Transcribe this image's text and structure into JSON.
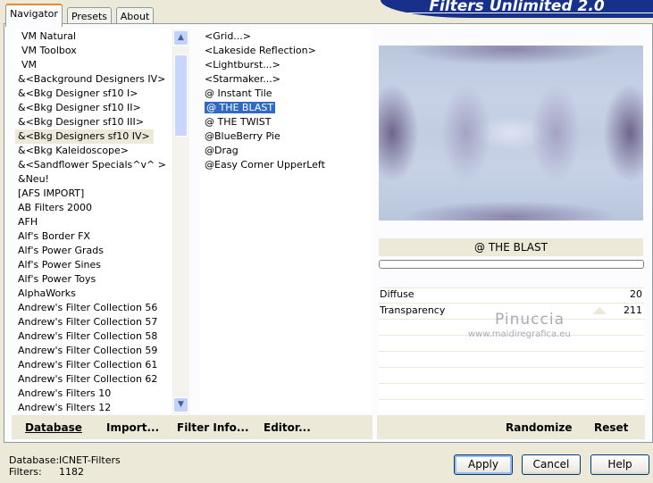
{
  "tabs": [
    {
      "label": "Navigator",
      "active": true
    },
    {
      "label": "Presets",
      "active": false
    },
    {
      "label": "About",
      "active": false
    }
  ],
  "banner": {
    "title": "Filters Unlimited 2.0"
  },
  "categories": [
    "VM Natural",
    "VM Toolbox",
    "VM",
    "&<Background Designers IV>",
    "&<Bkg Designer sf10 I>",
    "&<Bkg Designer sf10 II>",
    "&<Bkg Designer sf10 III>",
    "&<Bkg Designers sf10 IV>",
    "&<Bkg Kaleidoscope>",
    "&<Sandflower Specials^v^ >",
    "&Neu!",
    "[AFS IMPORT]",
    "AB Filters 2000",
    "AFH",
    "Alf's Border FX",
    "Alf's Power Grads",
    "Alf's Power Sines",
    "Alf's Power Toys",
    "AlphaWorks",
    "Andrew's Filter Collection 56",
    "Andrew's Filter Collection 57",
    "Andrew's Filter Collection 58",
    "Andrew's Filter Collection 59",
    "Andrew's Filter Collection 61",
    "Andrew's Filter Collection 62",
    "Andrew's Filters 10",
    "Andrew's Filters 12"
  ],
  "filters": [
    "<Grid...>",
    "<Lakeside Reflection>",
    "<Lightburst...>",
    "<Starmaker...>",
    "@ Instant Tile",
    "@ THE BLAST",
    "@ THE TWIST",
    "@BlueBerry Pie",
    "@Drag",
    "@Easy Corner UpperLeft"
  ],
  "bottom_buttons": {
    "database": "Database",
    "import": "Import...",
    "filter_info": "Filter Info...",
    "editor": "Editor...",
    "randomize": "Randomize",
    "reset": "Reset"
  },
  "preview": {
    "filter_name": "@ THE BLAST"
  },
  "params": [
    {
      "name": "Diffuse",
      "value": "20"
    },
    {
      "name": "Transparency",
      "value": "211"
    }
  ],
  "watermark": {
    "line1": "Pinuccia",
    "line2": "www.maidiregrafica.eu"
  },
  "status": {
    "database_label": "Database:",
    "database_value": "ICNET-Filters",
    "filters_label": "Filters:",
    "filters_value": "1182"
  },
  "dialog_buttons": {
    "apply": "Apply",
    "cancel": "Cancel",
    "help": "Help"
  }
}
